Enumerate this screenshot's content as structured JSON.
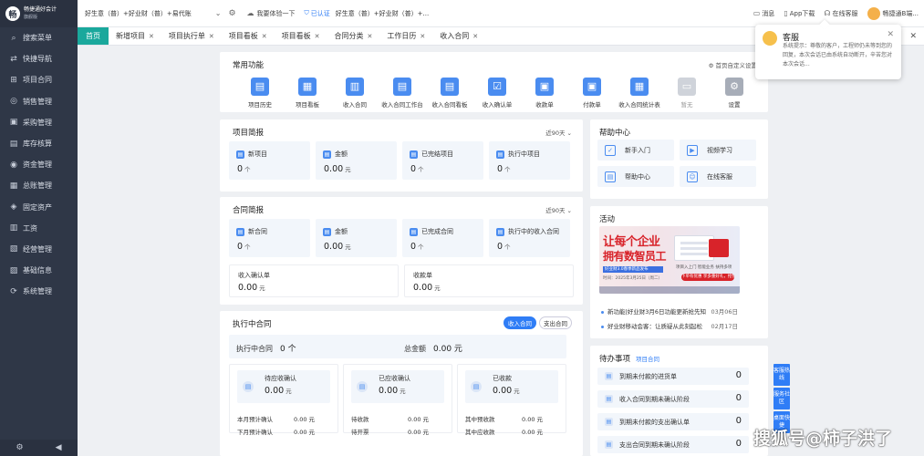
{
  "brand": {
    "logo_glyph": "畅",
    "name": "畅捷通好会计",
    "edition": "旗舰版"
  },
  "sidebar": {
    "items": [
      {
        "label": "搜索菜单",
        "icon": "search-icon",
        "glyph": "⌕"
      },
      {
        "label": "快捷导航",
        "icon": "shortcut-icon",
        "glyph": "⇄"
      },
      {
        "label": "项目合同",
        "icon": "project-icon",
        "glyph": "⊞"
      },
      {
        "label": "销售管理",
        "icon": "sales-icon",
        "glyph": "◎"
      },
      {
        "label": "采购管理",
        "icon": "purchase-icon",
        "glyph": "▣"
      },
      {
        "label": "库存核算",
        "icon": "inventory-icon",
        "glyph": "▤"
      },
      {
        "label": "资金管理",
        "icon": "fund-icon",
        "glyph": "◉"
      },
      {
        "label": "总账管理",
        "icon": "ledger-icon",
        "glyph": "▦"
      },
      {
        "label": "固定资产",
        "icon": "asset-icon",
        "glyph": "◈"
      },
      {
        "label": "工资",
        "icon": "salary-icon",
        "glyph": "▥"
      },
      {
        "label": "经营管理",
        "icon": "operation-icon",
        "glyph": "▧"
      },
      {
        "label": "基础信息",
        "icon": "info-icon",
        "glyph": "▨"
      },
      {
        "label": "系统管理",
        "icon": "system-icon",
        "glyph": "⟳"
      }
    ],
    "bottom": {
      "settings_glyph": "⚙",
      "collapse_glyph": "◀"
    }
  },
  "topbar": {
    "product_select": "好生意（普）+好业财（普）+易代账",
    "trial_label": "我要体验一下",
    "verified_label": "已认证",
    "product_tail": "好生意（普）+好业财（普）+...",
    "message_label": "消息",
    "app_label": "App下载",
    "service_label": "在线客服",
    "user_label": "畅捷通B端..."
  },
  "tabs": [
    {
      "label": "首页",
      "home": true
    },
    {
      "label": "新增项目"
    },
    {
      "label": "项目执行单"
    },
    {
      "label": "项目看板"
    },
    {
      "label": "项目看板"
    },
    {
      "label": "合同分类"
    },
    {
      "label": "工作日历"
    },
    {
      "label": "收入合同"
    }
  ],
  "common_functions": {
    "title": "常用功能",
    "settings_link": "首页自定义设置",
    "items": [
      {
        "label": "项目历史",
        "icon": "history-icon",
        "glyph": "▤"
      },
      {
        "label": "项目看板",
        "icon": "board-icon",
        "glyph": "▦"
      },
      {
        "label": "收入合同",
        "icon": "contract-icon",
        "glyph": "▥"
      },
      {
        "label": "收入合同工作台",
        "icon": "workbench-icon",
        "glyph": "▤"
      },
      {
        "label": "收入合同看板",
        "icon": "contract-board-icon",
        "glyph": "▤"
      },
      {
        "label": "收入确认单",
        "icon": "confirm-icon",
        "glyph": "☑"
      },
      {
        "label": "收款单",
        "icon": "receipt-icon",
        "glyph": "▣"
      },
      {
        "label": "付款单",
        "icon": "payment-icon",
        "glyph": "▣"
      },
      {
        "label": "收入合同统计表",
        "icon": "stats-icon",
        "glyph": "▦"
      },
      {
        "label": "暂无",
        "icon": "empty-icon",
        "glyph": "▭",
        "muted": true
      },
      {
        "label": "设置",
        "icon": "gear-icon",
        "glyph": "⚙",
        "dark": true
      }
    ]
  },
  "project_brief": {
    "title": "项目简报",
    "period": "近90天",
    "stats": [
      {
        "label": "新项目",
        "value": "0",
        "unit": "个"
      },
      {
        "label": "金额",
        "value": "0.00",
        "unit": "元"
      },
      {
        "label": "已完结项目",
        "value": "0",
        "unit": "个"
      },
      {
        "label": "执行中项目",
        "value": "0",
        "unit": "个"
      }
    ]
  },
  "contract_brief": {
    "title": "合同简报",
    "period": "近90天",
    "stats": [
      {
        "label": "新合同",
        "value": "0",
        "unit": "个"
      },
      {
        "label": "金额",
        "value": "0.00",
        "unit": "元"
      },
      {
        "label": "已完成合同",
        "value": "0",
        "unit": "个"
      },
      {
        "label": "执行中的收入合同",
        "value": "0",
        "unit": "个"
      }
    ],
    "boxes": [
      {
        "label": "收入确认单",
        "value": "0.00",
        "unit": "元"
      },
      {
        "label": "收款单",
        "value": "0.00",
        "unit": "元"
      }
    ]
  },
  "executing_contracts": {
    "title": "执行中合同",
    "toggle": [
      "收入合同",
      "支出合同"
    ],
    "summary_label": "执行中合同",
    "summary_value": "0 个",
    "total_label": "总金额",
    "total_value": "0.00 元",
    "cards": [
      {
        "title": "待应收确认",
        "value": "0.00",
        "unit": "元",
        "rows": [
          {
            "label": "本月预计确认",
            "value": "0.00 元"
          },
          {
            "label": "下月预计确认",
            "value": "0.00 元"
          }
        ]
      },
      {
        "title": "已应收确认",
        "value": "0.00",
        "unit": "元",
        "rows": [
          {
            "label": "待收款",
            "value": "0.00 元"
          },
          {
            "label": "待开票",
            "value": "0.00 元"
          }
        ]
      },
      {
        "title": "已收款",
        "value": "0.00",
        "unit": "元",
        "rows": [
          {
            "label": "其中预收款",
            "value": "0.00 元"
          },
          {
            "label": "其中应收款",
            "value": "0.00 元"
          }
        ]
      }
    ]
  },
  "help_center": {
    "title": "帮助中心",
    "items": [
      {
        "label": "新手入门",
        "icon": "guide-icon",
        "glyph": "✓"
      },
      {
        "label": "视频学习",
        "icon": "video-icon",
        "glyph": "▶"
      },
      {
        "label": "帮助中心",
        "icon": "help-doc-icon",
        "glyph": "▤"
      },
      {
        "label": "在线客服",
        "icon": "headset-icon",
        "glyph": "☺"
      }
    ]
  },
  "activity": {
    "title": "活动",
    "banner": {
      "line1": "让每个企业",
      "line2": "拥有数智员工",
      "strip": "好业财3.0春季新品发布",
      "date": "时间：2025年3月25日（周二）",
      "tags": "项目入上门  智能业务  扶持多项",
      "button": "下单有优惠 享多重好礼，抢快行动！"
    },
    "news": [
      {
        "text": "新功能|好业财3月6日功能更新抢先知",
        "date": "03月06日"
      },
      {
        "text": "好业财移动会客：让质疑从此刻起松",
        "date": "02月17日"
      }
    ]
  },
  "todo": {
    "title": "待办事项",
    "tag": "项目合同",
    "items": [
      {
        "label": "到期未付款的进货单",
        "value": "0"
      },
      {
        "label": "收入合同到期未确认阶段",
        "value": "0"
      },
      {
        "label": "到期未付款的支出确认单",
        "value": "0"
      },
      {
        "label": "支出合同到期未确认阶段",
        "value": "0"
      }
    ]
  },
  "side_tabs": [
    "客服热线",
    "服务社区",
    "桌面快捷"
  ],
  "popup": {
    "title": "客服",
    "body": "系统提示：尊敬的客户，工程师仍未等到您的回复，本次会话已由系统自动断开，辛苦您对本次会话..."
  },
  "watermark": "搜狐号@柿子洪了",
  "colors": {
    "accent": "#2f7df6",
    "home_tab": "#1aa89c",
    "sidebar": "#2f3747"
  }
}
